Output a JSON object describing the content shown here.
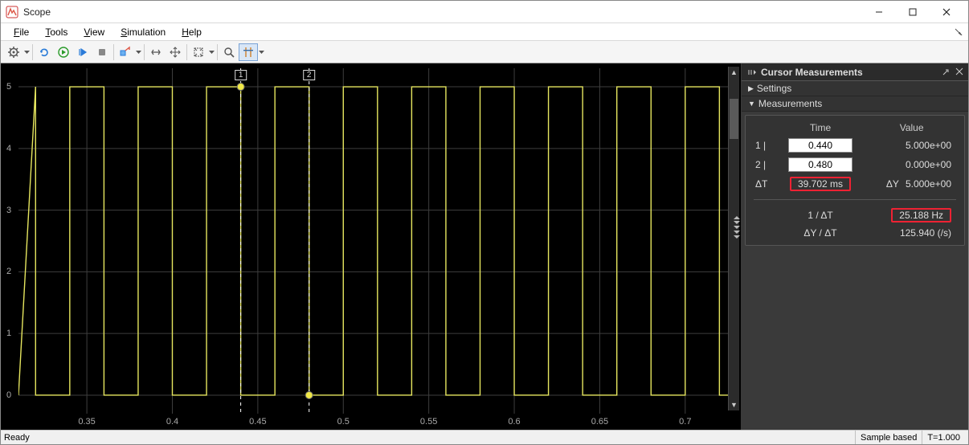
{
  "window": {
    "title": "Scope"
  },
  "menubar": {
    "file": "File",
    "tools": "Tools",
    "view": "View",
    "simulation": "Simulation",
    "help": "Help"
  },
  "status": {
    "ready": "Ready",
    "sample": "Sample based",
    "time": "T=1.000"
  },
  "cursor_panel": {
    "title": "Cursor Measurements",
    "settings": "Settings",
    "measurements": "Measurements",
    "h_time": "Time",
    "h_value": "Value",
    "r1_label": "1 |",
    "r1_time": "0.440",
    "r1_val": "5.000e+00",
    "r2_label": "2 |",
    "r2_time": "0.480",
    "r2_val": "0.000e+00",
    "dT_label": "ΔT",
    "dT_val": "39.702 ms",
    "dY_label": "ΔY",
    "dY_val": "5.000e+00",
    "invdT_label": "1 / ΔT",
    "invdT_val": "25.188 Hz",
    "slope_label": "ΔY / ΔT",
    "slope_val": "125.940 (/s)"
  },
  "plot": {
    "cursor1_label": "1",
    "cursor2_label": "2",
    "y_ticks": [
      5,
      4,
      3,
      2,
      1,
      0
    ],
    "x_ticks": [
      "0.35",
      "0.4",
      "0.45",
      "0.5",
      "0.55",
      "0.6",
      "0.65",
      "0.7"
    ]
  },
  "chart_data": {
    "type": "line",
    "title": "",
    "xlabel": "",
    "ylabel": "",
    "xlim": [
      0.31,
      0.725
    ],
    "ylim": [
      -0.3,
      5.3
    ],
    "square_wave": {
      "low": 0,
      "high": 5,
      "period_s": 0.04,
      "duty": 0.5,
      "phase_offset_s": 0.0
    },
    "cursors": [
      {
        "id": 1,
        "t": 0.44,
        "y": 5.0
      },
      {
        "id": 2,
        "t": 0.48,
        "y": 0.0
      }
    ],
    "derived": {
      "dT_ms": 39.702,
      "dY": 5.0,
      "inv_dT_Hz": 25.188,
      "slope_per_s": 125.94
    }
  }
}
